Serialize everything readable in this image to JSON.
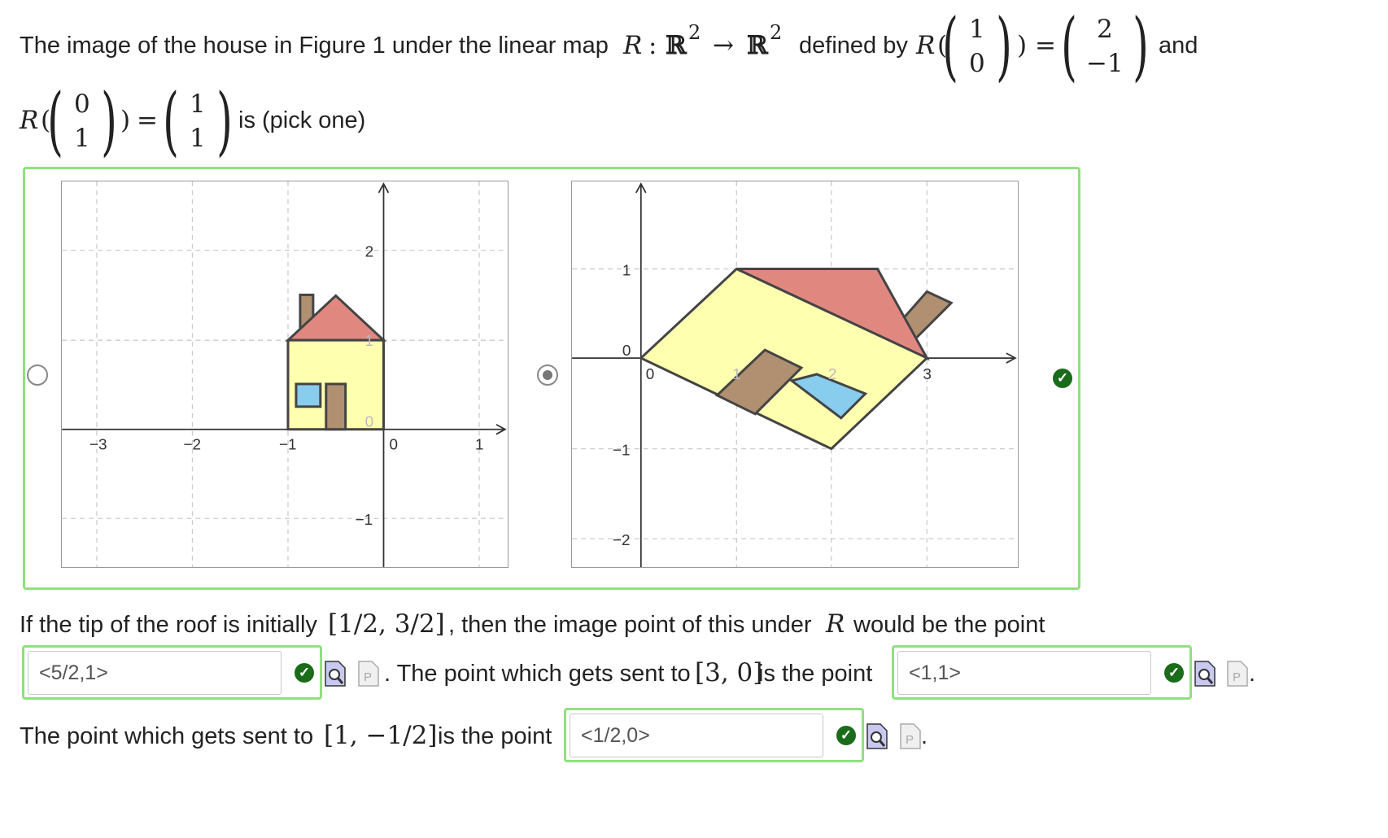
{
  "question": {
    "intro": "The image of the house in Figure 1 under the linear map",
    "map_symbol": "R",
    "map_colon": ":",
    "domain": "ℝ",
    "codomain": "ℝ",
    "dimension": "2",
    "arrow": "→",
    "defined_by": "defined by",
    "and": "and",
    "pick_one": "is (pick one)",
    "v1_in": [
      "1",
      "0"
    ],
    "v1_out": [
      "2",
      "−1"
    ],
    "v2_in": [
      "0",
      "1"
    ],
    "v2_out": [
      "1",
      "1"
    ]
  },
  "choices": {
    "selected_index": 1,
    "left_plot": {
      "x_ticks": [
        "−3",
        "−2",
        "−1",
        "0",
        "1"
      ],
      "y_ticks": [
        "2",
        "1",
        "0",
        "−1"
      ]
    },
    "right_plot": {
      "x_ticks": [
        "0",
        "1",
        "2",
        "3"
      ],
      "y_ticks": [
        "1",
        "0",
        "−1",
        "−2"
      ]
    }
  },
  "part2": {
    "sentence_a": "If the tip of the roof is initially",
    "point_a": "[1/2, 3/2]",
    "sentence_b": ", then the image point of this under",
    "map_symbol": "R",
    "sentence_c": "would be the point",
    "answer1": "<5/2,1>",
    "mid_text": ". The point which gets sent to",
    "point_b": "[3, 0]",
    "is_the_point": "is the point",
    "answer2": "<1,1>",
    "line3_text": "The point which gets sent to",
    "point_c": "[1, −1/2]",
    "is_the_point_2": "is the point",
    "answer3": "<1/2,0>",
    "period": "."
  },
  "colors": {
    "correct_border": "#90e080",
    "check": "#1a6b1a",
    "house_wall": "#ffffb0",
    "roof": "#e08880",
    "chimney_door": "#b09070",
    "window": "#88ccee"
  }
}
